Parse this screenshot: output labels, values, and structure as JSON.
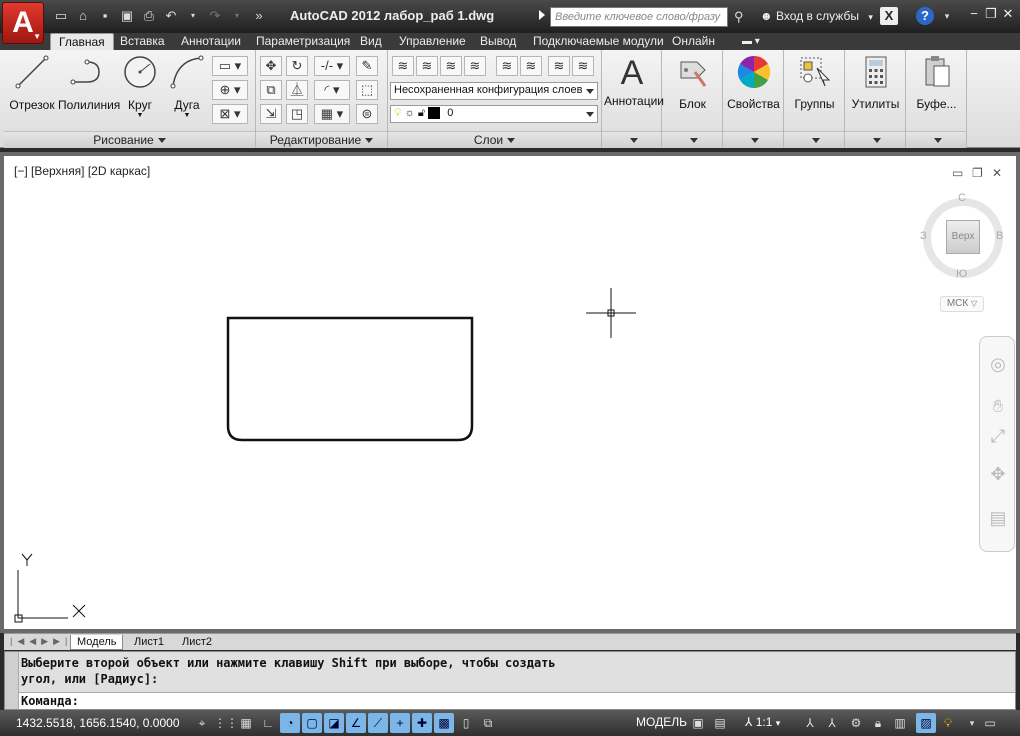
{
  "titlebar": {
    "app_letter": "A",
    "title": "AutoCAD 2012    лабор_раб 1.dwg",
    "search_placeholder": "Введите ключевое слово/фразу",
    "login": "Вход в службы",
    "x_label": "X",
    "help_label": "?"
  },
  "ribbon_tabs": [
    "Главная",
    "Вставка",
    "Аннотации",
    "Параметризация",
    "Вид",
    "Управление",
    "Вывод",
    "Подключаемые модули",
    "Онлайн"
  ],
  "draw_panel": {
    "tools": [
      "Отрезок",
      "Полилиния",
      "Круг",
      "Дуга"
    ],
    "footer": "Рисование"
  },
  "edit_panel": {
    "footer": "Редактирование"
  },
  "layers_panel": {
    "layer_state": "Несохраненная конфигурация слоев",
    "current_layer": "0",
    "footer": "Слои"
  },
  "big_panels": [
    "Аннотации",
    "Блок",
    "Свойства",
    "Группы",
    "Утилиты",
    "Буфе..."
  ],
  "viewport": {
    "label": "[−] [Верхняя] [2D каркас]",
    "cube_top": "Верх",
    "north": "С",
    "south": "Ю",
    "west": "З",
    "east": "В",
    "wcs": "МСК",
    "ucs_x": "X",
    "ucs_y": "Y"
  },
  "layout_tabs": [
    "Модель",
    "Лист1",
    "Лист2"
  ],
  "command": {
    "history_line1": "Выберите второй объект или нажмите клавишу Shift при выборе, чтобы создать",
    "history_line2": "угол, или [Радиус]:",
    "prompt": "Команда:"
  },
  "statusbar": {
    "coords": "1432.5518, 1656.1540, 0.0000",
    "model": "МОДЕЛЬ",
    "scale": "1:1"
  }
}
